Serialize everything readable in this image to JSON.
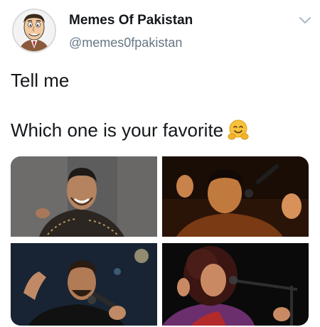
{
  "account": {
    "display_name": "Memes Of Pakistan",
    "handle": "@memes0fpakistan"
  },
  "tweet": {
    "text_line_1": "Tell me",
    "text_line_2": "Which one is your favorite",
    "emoji": "hugging-face-emoji"
  },
  "icons": {
    "menu": "chevron-down-icon"
  },
  "colors": {
    "text_primary": "#14171a",
    "text_secondary": "#657786",
    "chevron": "#aab8c2"
  }
}
